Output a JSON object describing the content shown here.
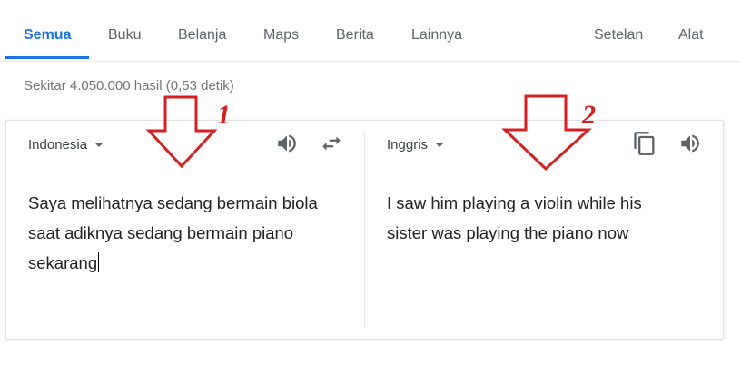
{
  "tabs": [
    {
      "label": "Semua"
    },
    {
      "label": "Buku"
    },
    {
      "label": "Belanja"
    },
    {
      "label": "Maps"
    },
    {
      "label": "Berita"
    },
    {
      "label": "Lainnya"
    }
  ],
  "tools": {
    "settings_label": "Setelan",
    "tools_label": "Alat"
  },
  "result_stats": "Sekitar 4.050.000 hasil (0,53 detik)",
  "translate": {
    "source_lang": "Indonesia",
    "target_lang": "Inggris",
    "source_text_line1": "Saya melihatnya sedang bermain biola",
    "source_text_line2": "saat adiknya sedang bermain piano",
    "source_text_line3": "sekarang",
    "target_text_line1": "I saw him playing a violin while his",
    "target_text_line2": "sister was playing the piano now"
  },
  "annotations": {
    "label1": "1",
    "label2": "2"
  },
  "colors": {
    "accent": "#1a73e8",
    "annotation": "#d61f1f"
  },
  "icons": [
    "speaker-icon",
    "swap-icon",
    "copy-icon",
    "speaker-icon"
  ]
}
